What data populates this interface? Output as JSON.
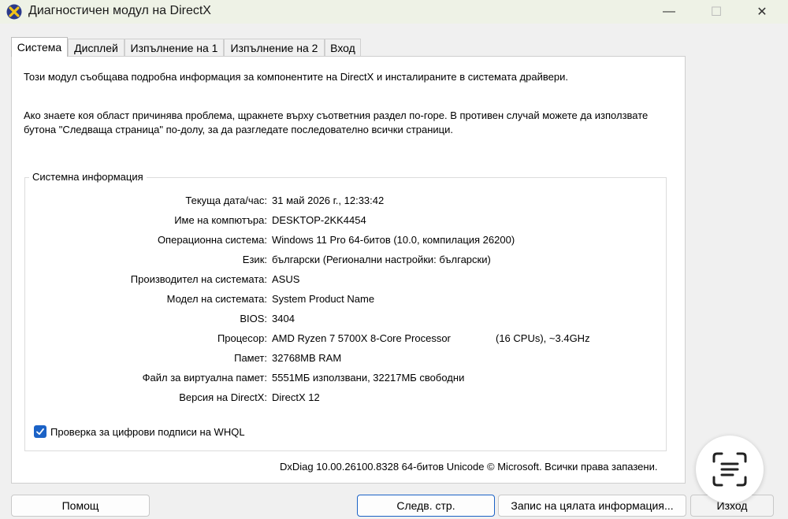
{
  "window": {
    "title": "Диагностичен модул на DirectX",
    "icon": "directx-x-icon",
    "controls": {
      "minimize": "—",
      "maximize": "☐",
      "close": "✕"
    }
  },
  "tabs": [
    {
      "label": "Система",
      "active": true
    },
    {
      "label": "Дисплей",
      "active": false
    },
    {
      "label": "Изпълнение на 1",
      "active": false
    },
    {
      "label": "Изпълнение на 2",
      "active": false
    },
    {
      "label": "Вход",
      "active": false
    }
  ],
  "intro": "Този модул съобщава подробна информация за компонентите на DirectX и инсталираните в системата драйвери.",
  "intro2": "Ако знаете коя област причинява проблема, щракнете върху съответния раздел по-горе. В противен случай можете да използвате бутона \"Следваща страница\" по-долу, за да разгледате последователно всички страници.",
  "system_info": {
    "legend": "Системна информация",
    "rows": [
      {
        "label": "Текуща дата/час:",
        "value": "31 май 2026 г., 12:33:42"
      },
      {
        "label": "Име на компютъра:",
        "value": "DESKTOP-2KK4454"
      },
      {
        "label": "Операционна система:",
        "value": "Windows 11 Pro 64-битов (10.0, компилация 26200)"
      },
      {
        "label": "Език:",
        "value": "български (Регионални настройки: български)"
      },
      {
        "label": "Производител на системата:",
        "value": "ASUS"
      },
      {
        "label": "Модел на системата:",
        "value": "System Product Name"
      },
      {
        "label": "BIOS:",
        "value": "3404"
      },
      {
        "label": "Процесор:",
        "value": "AMD Ryzen 7 5700X 8-Core Processor",
        "value2": "(16 CPUs), ~3.4GHz"
      },
      {
        "label": "Памет:",
        "value": "32768MB RAM"
      },
      {
        "label": "Файл за виртуална памет:",
        "value": "5551МБ използвани, 32217МБ свободни"
      },
      {
        "label": "Версия на DirectX:",
        "value": "DirectX 12"
      }
    ]
  },
  "whql": {
    "label": "Проверка за цифрови подписи на WHQL",
    "checked": true
  },
  "copyright": "DxDiag 10.00.26100.8328 64-битов Unicode © Microsoft. Всички права запазени.",
  "buttons": {
    "help": "Помощ",
    "next": "Следв. стр.",
    "save": "Запис на цялата информация...",
    "exit": "Изход"
  },
  "colors": {
    "accent": "#1b62c6",
    "titlebar": "#eef2e6"
  },
  "overlay": {
    "icon": "text-scan-icon"
  }
}
